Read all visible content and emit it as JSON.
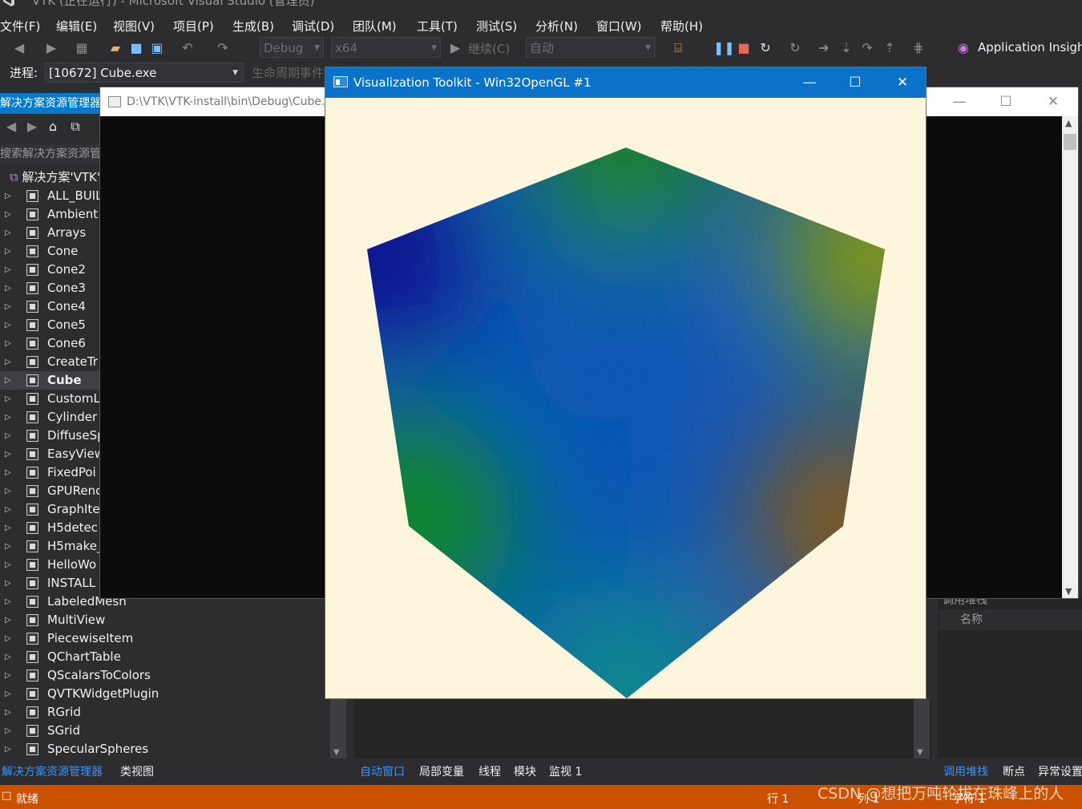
{
  "vs": {
    "title": "VTK (正在运行) - Microsoft Visual Studio (管理员)",
    "menu": [
      "文件(F)",
      "编辑(E)",
      "视图(V)",
      "项目(P)",
      "生成(B)",
      "调试(D)",
      "团队(M)",
      "工具(T)",
      "测试(S)",
      "分析(N)",
      "窗口(W)",
      "帮助(H)"
    ],
    "toolbar": {
      "config": "Debug",
      "platform": "x64",
      "continue_label": "继续(C)",
      "auto": "自动",
      "app_insights": "Application Insights"
    },
    "process": {
      "label": "进程:",
      "value": "[10672] Cube.exe",
      "lifecycle": "生命周期事件"
    }
  },
  "solution_explorer": {
    "header": "解决方案资源管理器",
    "search_placeholder": "搜索解决方案资源管理器",
    "root": "解决方案'VTK'",
    "items": [
      {
        "label": "ALL_BUILD"
      },
      {
        "label": "Ambient"
      },
      {
        "label": "Arrays"
      },
      {
        "label": "Cone"
      },
      {
        "label": "Cone2"
      },
      {
        "label": "Cone3"
      },
      {
        "label": "Cone4"
      },
      {
        "label": "Cone5"
      },
      {
        "label": "Cone6"
      },
      {
        "label": "CreateTr"
      },
      {
        "label": "Cube",
        "selected": true
      },
      {
        "label": "CustomL"
      },
      {
        "label": "Cylinder"
      },
      {
        "label": "DiffuseSp"
      },
      {
        "label": "EasyView"
      },
      {
        "label": "FixedPoi"
      },
      {
        "label": "GPURenc"
      },
      {
        "label": "GraphIte"
      },
      {
        "label": "H5detec"
      },
      {
        "label": "H5make_"
      },
      {
        "label": "HelloWo"
      },
      {
        "label": "INSTALL"
      },
      {
        "label": "LabeledMesh"
      },
      {
        "label": "MultiView"
      },
      {
        "label": "PiecewiseItem"
      },
      {
        "label": "QChartTable"
      },
      {
        "label": "QScalarsToColors"
      },
      {
        "label": "QVTKWidgetPlugin"
      },
      {
        "label": "RGrid"
      },
      {
        "label": "SGrid"
      },
      {
        "label": "SpecularSpheres"
      }
    ]
  },
  "console": {
    "title": "D:\\VTK\\VTK-install\\bin\\Debug\\Cube.exe"
  },
  "vtk_window": {
    "title": "Visualization Toolkit - Win32OpenGL #1",
    "background": "#fdf5dc",
    "cube_colors": {
      "top": "#23860f",
      "left_top": "#0a0a8c",
      "right_top": "#869a0a",
      "center": "#0a56b4",
      "left_bottom": "#0a8c1e",
      "right_bottom": "#8c5a0a",
      "bottom": "#0a8c8c"
    }
  },
  "callstack": {
    "title": "调用堆栈",
    "column": "名称"
  },
  "bottom_tabs_left": [
    "解决方案资源管理器",
    "类视图"
  ],
  "bottom_tabs_mid": [
    "自动窗口",
    "局部变量",
    "线程",
    "模块",
    "监视 1"
  ],
  "bottom_tabs_right": [
    "调用堆栈",
    "断点",
    "异常设置"
  ],
  "status": {
    "ready": "就绪",
    "row": "行 1",
    "col": "列 1",
    "char": "字符 1"
  },
  "watermark": "CSDN @想把万吨轮拔在珠峰上的人",
  "caption_buttons": {
    "minimize": "—",
    "maximize": "☐",
    "close": "✕"
  }
}
